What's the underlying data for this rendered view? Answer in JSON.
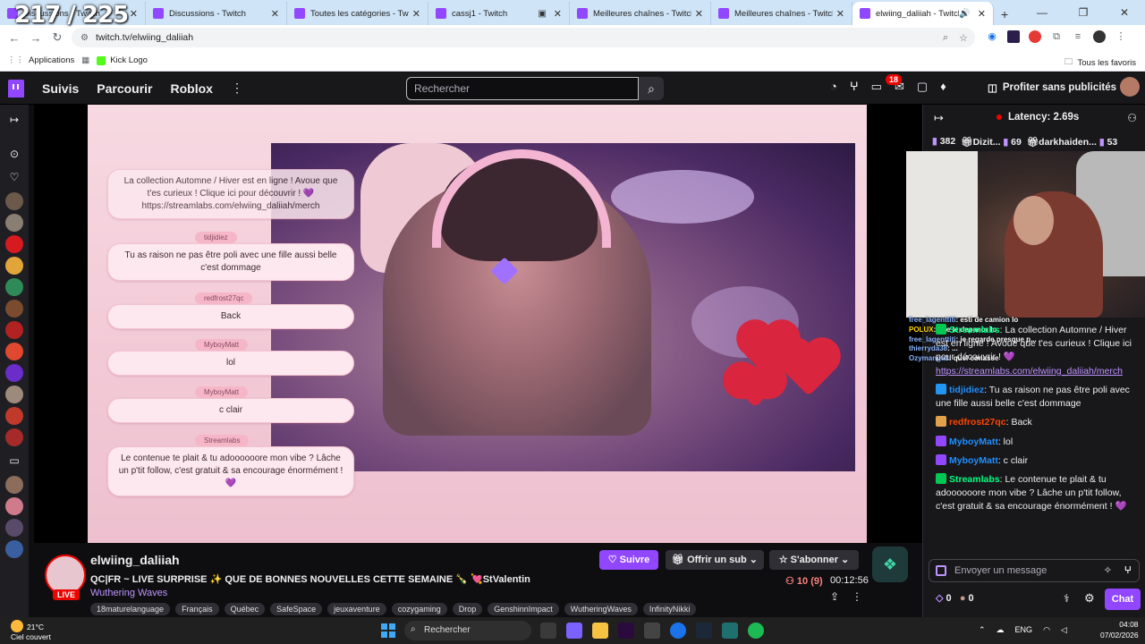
{
  "overlay_counter": "217 / 225",
  "browser": {
    "tabs": [
      {
        "label": "Discussions - Twitch",
        "prefix": "",
        "active": false
      },
      {
        "label": "Discussions - Twitch",
        "prefix": "",
        "active": false
      },
      {
        "label": "Toutes les catégories - Twitch",
        "prefix": "",
        "active": false
      },
      {
        "label": "cassj1 - Twitch",
        "prefix": "",
        "active": false
      },
      {
        "label": "Meilleures chaînes - Twitch",
        "prefix": "",
        "active": false
      },
      {
        "label": "Meilleures chaînes - Twitch",
        "prefix": "",
        "active": false
      },
      {
        "label": "elwiing_daliiah - Twitch",
        "prefix": "",
        "active": true
      }
    ],
    "url": "twitch.tv/elwiing_daliiah",
    "bookmarks": {
      "apps": "Applications",
      "kick": "Kick Logo",
      "all": "Tous les favoris"
    }
  },
  "twitch_nav": {
    "following": "Suivis",
    "browse": "Parcourir",
    "roblox": "Roblox",
    "search_placeholder": "Rechercher",
    "notif_count": "18",
    "adfree": "Profiter sans publicités"
  },
  "stream_overlay": [
    {
      "name": "",
      "text": "La collection Automne / Hiver est en ligne ! Avoue que t'es curieux ! Clique ici pour découvrir ! 💜 https://streamlabs.com/elwiing_daliiah/merch"
    },
    {
      "name": "tidjidiez",
      "text": "Tu as raison ne pas être poli avec une fille aussi belle c'est dommage"
    },
    {
      "name": "redfrost27qc",
      "text": "Back"
    },
    {
      "name": "MyboyMatt",
      "text": "lol"
    },
    {
      "name": "MyboyMatt",
      "text": "c clair"
    },
    {
      "name": "Streamlabs",
      "text": "Le contenue te plait & tu adoooooore mon vibe ? Lâche un p'tit follow, c'est gratuit & sa encourage énormément ! 💜"
    }
  ],
  "channel": {
    "name": "elwiing_daliiah",
    "live": "LIVE",
    "title": "QC|FR ~ LIVE SURPRISE ✨ QUE DE BONNES NOUVELLES CETTE SEMAINE 🍾 💘StValentin",
    "game": "Wuthering Waves",
    "tags": [
      "18maturelanguage",
      "Français",
      "Québec",
      "SafeSpace",
      "jeuxaventure",
      "cozygaming",
      "Drop",
      "GenshinnImpact",
      "WutheringWaves",
      "InfinityNikki"
    ],
    "follow": "Suivre",
    "gift": "Offrir un sub",
    "subscribe": "S'abonner",
    "viewers": "10 (9)",
    "uptime": "00:12:56"
  },
  "chat": {
    "latency": "Latency: 2.69s",
    "leaderboard": [
      {
        "rank": "",
        "name": "382"
      },
      {
        "rank": "",
        "name": "Dizit...",
        "value": "69"
      },
      {
        "rank": "",
        "name": "darkhaiden...",
        "value": "53"
      }
    ],
    "cam_overlay": [
      {
        "name": "free_lagenttiti",
        "text": ": esti de camion lo"
      },
      {
        "name": "POLUX",
        "text": ": che le depanor lo"
      },
      {
        "name": "free_lagenttiti",
        "text": ": je regarde presque p..."
      },
      {
        "name": "thierryda38",
        "text": ": ..."
      },
      {
        "name": "Ozymanga2",
        "text": ": quel conasse"
      }
    ],
    "messages": [
      {
        "user": "Streamlabs",
        "cls": "u4",
        "text": ": La collection Automne / Hiver est en ligne ! Avoue que t'es curieux ! Clique ici pour découvrir ! 💜",
        "link": "https://streamlabs.com/elwiing_daliiah/merch"
      },
      {
        "user": "tidjidiez",
        "cls": "u1",
        "text": ": Tu as raison ne pas être poli avec une fille aussi belle c'est dommage"
      },
      {
        "user": "redfrost27qc",
        "cls": "u2",
        "text": ": Back"
      },
      {
        "user": "MyboyMatt",
        "cls": "u1",
        "text": ": lol"
      },
      {
        "user": "MyboyMatt",
        "cls": "u1",
        "text": ": c clair"
      },
      {
        "user": "Streamlabs",
        "cls": "u4",
        "text": ": Le contenue te plait & tu adoooooore mon vibe ? Lâche un p'tit follow, c'est gratuit & sa encourage énormément ! 💜"
      }
    ],
    "input_placeholder": "Envoyer un message",
    "points_a": "0",
    "points_b": "0",
    "send": "Chat"
  },
  "taskbar": {
    "temp": "21°C",
    "weather": "Ciel couvert",
    "search": "Rechercher",
    "lang": "ENG",
    "time": "04:08",
    "date": "07/02/2026"
  },
  "colors": {
    "twitch_purple": "#9146ff",
    "live_red": "#eb0400"
  }
}
